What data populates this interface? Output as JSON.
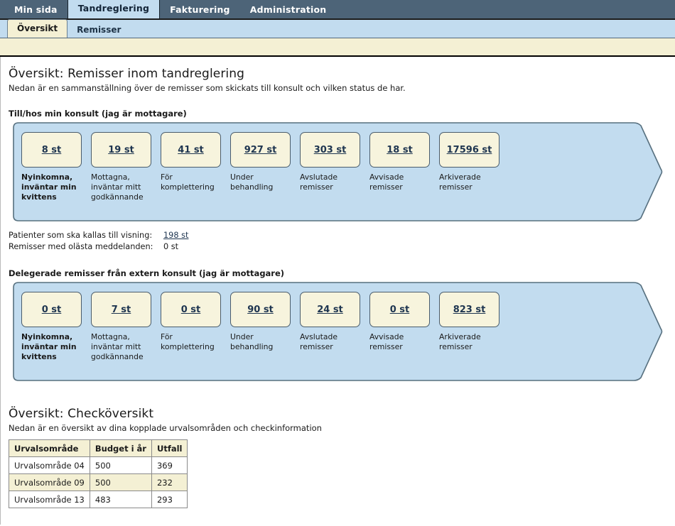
{
  "main_tabs": [
    {
      "label": "Min sida",
      "active": false
    },
    {
      "label": "Tandreglering",
      "active": true
    },
    {
      "label": "Fakturering",
      "active": false
    },
    {
      "label": "Administration",
      "active": false
    }
  ],
  "sub_tabs": [
    {
      "label": "Översikt",
      "active": true
    },
    {
      "label": "Remisser",
      "active": false
    }
  ],
  "overview": {
    "title": "Översikt: Remisser inom tandreglering",
    "subtitle": "Nedan är en sammanställning över de remisser som skickats till konsult och vilken status de har."
  },
  "panel1": {
    "heading": "Till/hos min konsult (jag är mottagare)",
    "boxes": [
      {
        "value": "8 st",
        "caption": "Nyinkomna, inväntar min kvittens"
      },
      {
        "value": "19 st",
        "caption": "Mottagna, inväntar mitt godkännande"
      },
      {
        "value": "41 st",
        "caption": "För komplettering"
      },
      {
        "value": "927 st",
        "caption": "Under behandling"
      },
      {
        "value": "303 st",
        "caption": "Avslutade remisser"
      },
      {
        "value": "18 st",
        "caption": "Avvisade remisser"
      },
      {
        "value": "17596 st",
        "caption": "Arkiverade remisser"
      }
    ]
  },
  "middle_stats": [
    {
      "label": "Patienter som ska kallas till visning:",
      "value": "198 st",
      "is_link": true
    },
    {
      "label": "Remisser med olästa meddelanden:",
      "value": "0 st",
      "is_link": false
    }
  ],
  "panel2": {
    "heading": "Delegerade remisser från extern konsult (jag är mottagare)",
    "boxes": [
      {
        "value": "0 st",
        "caption": "Nyinkomna, inväntar min kvittens"
      },
      {
        "value": "7 st",
        "caption": "Mottagna, inväntar mitt godkännande"
      },
      {
        "value": "0 st",
        "caption": "För komplettering"
      },
      {
        "value": "90 st",
        "caption": "Under behandling"
      },
      {
        "value": "24 st",
        "caption": "Avslutade remisser"
      },
      {
        "value": "0 st",
        "caption": "Avvisade remisser"
      },
      {
        "value": "823 st",
        "caption": "Arkiverade remisser"
      }
    ]
  },
  "check_overview": {
    "title": "Översikt: Checköversikt",
    "subtitle": "Nedan är en översikt av dina kopplade urvalsområden och checkinformation",
    "table": {
      "columns": [
        "Urvalsområde",
        "Budget i år",
        "Utfall"
      ],
      "rows": [
        [
          "Urvalsområde 04",
          "500",
          "369"
        ],
        [
          "Urvalsområde 09",
          "500",
          "232"
        ],
        [
          "Urvalsområde 13",
          "483",
          "293"
        ]
      ]
    }
  },
  "colors": {
    "header_bar": "#4d6478",
    "panel_blue": "#c2dcef",
    "box_cream": "#f7f4dd",
    "link": "#1e3550",
    "border": "#4a5c6b"
  }
}
